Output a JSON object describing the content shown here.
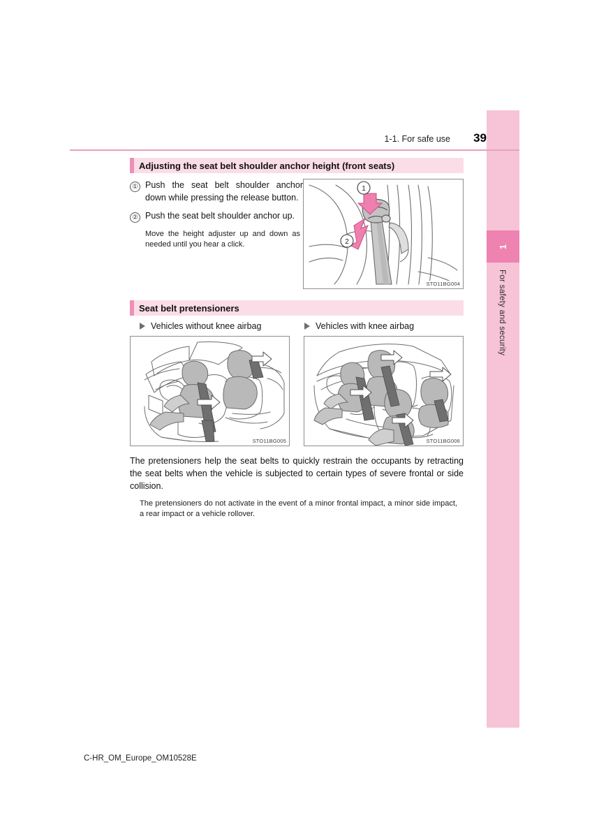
{
  "header": {
    "chapter": "1-1. For safe use",
    "page_number": "39"
  },
  "side_tab": {
    "number": "1",
    "label": "For safety and security",
    "color": "#f7c3d7",
    "number_color": "#ee82b0"
  },
  "sections": [
    {
      "id": "shoulder-anchor",
      "title": "Adjusting the seat belt shoulder anchor height (front seats)",
      "steps": [
        {
          "marker": "①",
          "text": "Push the seat belt shoulder anchor down while pressing the release button."
        },
        {
          "marker": "②",
          "text": "Push the seat belt shoulder anchor up."
        }
      ],
      "note": "Move the height adjuster up and down as needed until you hear a click.",
      "figure": {
        "code": "STO11BG004",
        "callout_1": "1",
        "callout_2": "2"
      }
    },
    {
      "id": "pretensioners",
      "title": "Seat belt pretensioners",
      "subheads": [
        {
          "label": "Vehicles without knee airbag"
        },
        {
          "label": "Vehicles with knee airbag"
        }
      ],
      "figures": [
        {
          "code": "STO11BG005"
        },
        {
          "code": "STO11BG006"
        }
      ],
      "paragraph": "The pretensioners help the seat belts to quickly restrain the occupants by retracting the seat belts when the vehicle is subjected to certain types of severe frontal or side collision.",
      "note": "The pretensioners do not activate in the event of a minor frontal impact, a minor side impact, a rear impact or a vehicle rollover."
    }
  ],
  "footer": {
    "document_code": "C-HR_OM_Europe_OM10528E"
  },
  "colors": {
    "accent_bar": "#ef8fb8",
    "section_bg": "#fbdde8",
    "rule": "#e8a0bd",
    "arrow_pink": "#ef7fae"
  }
}
